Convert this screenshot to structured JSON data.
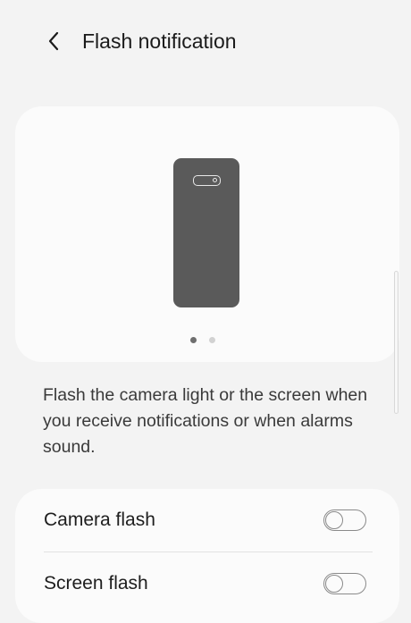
{
  "header": {
    "title": "Flash notification",
    "back_icon": "chevron-left-icon"
  },
  "hero": {
    "illustration": "phone-camera-icon",
    "page_indicator": {
      "count": 2,
      "active_index": 0
    }
  },
  "description": "Flash the camera light or the screen when you receive notifications or when alarms sound.",
  "settings": [
    {
      "label": "Camera flash",
      "enabled": false
    },
    {
      "label": "Screen flash",
      "enabled": false
    }
  ]
}
